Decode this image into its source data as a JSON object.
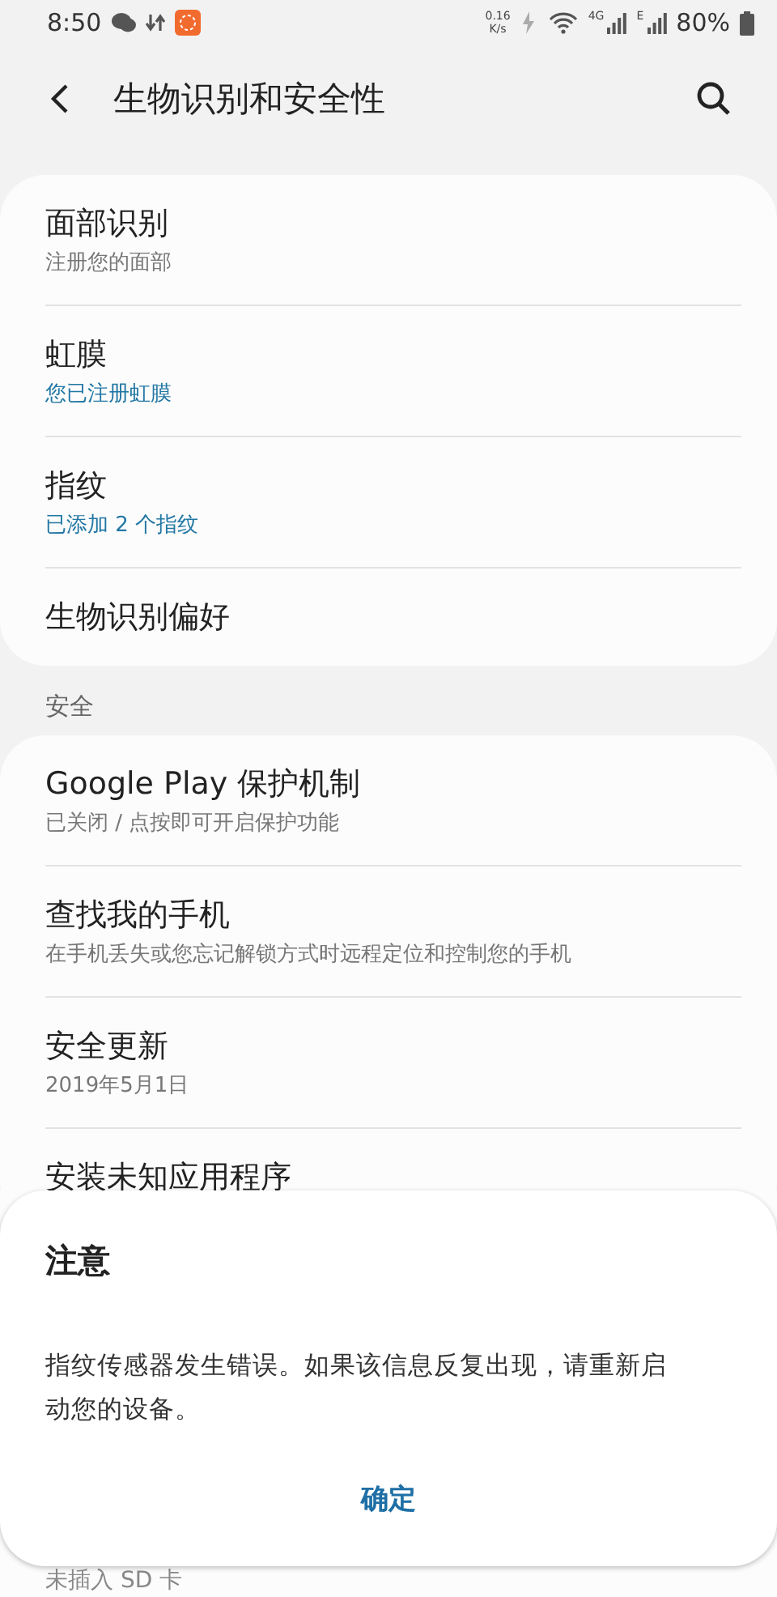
{
  "status_bar": {
    "time": "8:50",
    "net_speed_value": "0.16",
    "net_speed_unit": "K/s",
    "network_1": "4G",
    "network_2": "E",
    "battery": "80%"
  },
  "header": {
    "title": "生物识别和安全性"
  },
  "cards": [
    {
      "rows": [
        {
          "title": "面部识别",
          "subtitle": "注册您的面部",
          "accent": false
        },
        {
          "title": "虹膜",
          "subtitle": "您已注册虹膜",
          "accent": true
        },
        {
          "title": "指纹",
          "subtitle": "已添加 2 个指纹",
          "accent": true
        },
        {
          "title": "生物识别偏好"
        }
      ]
    },
    {
      "section": "安全",
      "rows": [
        {
          "title": "Google Play 保护机制",
          "subtitle": "已关闭 / 点按即可开启保护功能",
          "accent": false
        },
        {
          "title": "查找我的手机",
          "subtitle": "在手机丢失或您忘记解锁方式时远程定位和控制您的手机",
          "accent": false
        },
        {
          "title": "安全更新",
          "subtitle": "2019年5月1日",
          "accent": false
        },
        {
          "title": "安装未知应用程序"
        }
      ]
    }
  ],
  "dialog": {
    "title": "注意",
    "message": "指纹传感器发生错误。如果该信息反复出现，请重新启动您的设备。",
    "button": "确定"
  },
  "bottom_text": "未插入 SD 卡"
}
